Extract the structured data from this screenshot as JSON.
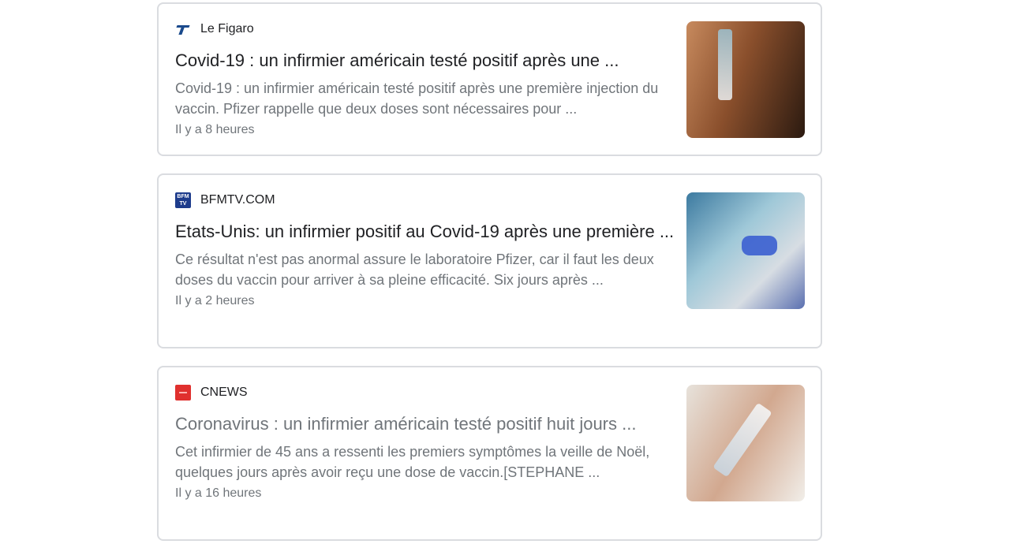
{
  "articles": [
    {
      "source": "Le Figaro",
      "favicon": "le-figaro-icon",
      "title": "Covid-19 : un infirmier américain testé positif après une ...",
      "snippet": "Covid-19 : un infirmier américain testé positif après une première injection du vaccin. Pfizer rappelle que deux doses sont nécessaires pour ...",
      "time": "Il y a 8 heures",
      "thumbnail": "vaccine-syringe-image"
    },
    {
      "source": "BFMTV.COM",
      "favicon": "bfmtv-icon",
      "favicon_text": "BFM TV",
      "title": "Etats-Unis: un infirmier positif au Covid-19 après une première ...",
      "snippet": "Ce résultat n'est pas anormal assure le laboratoire Pfizer, car il faut les deux doses du vaccin pour arriver à sa pleine efficacité. Six jours après ...",
      "time": "Il y a 2 heures",
      "thumbnail": "nurse-vaccination-image"
    },
    {
      "source": "CNEWS",
      "favicon": "cnews-icon",
      "title": "Coronavirus : un infirmier américain testé positif huit jours ...",
      "snippet": "Cet infirmier de 45 ans a ressenti les premiers symptômes la veille de Noël, quelques jours après avoir reçu une dose de vaccin.[STEPHANE ...",
      "time": "Il y a 16 heures",
      "thumbnail": "vaccine-vial-image"
    }
  ],
  "colors": {
    "title_dark": "#202124",
    "title_visited": "#70757a",
    "snippet": "#70757a",
    "border": "#dadce0"
  }
}
